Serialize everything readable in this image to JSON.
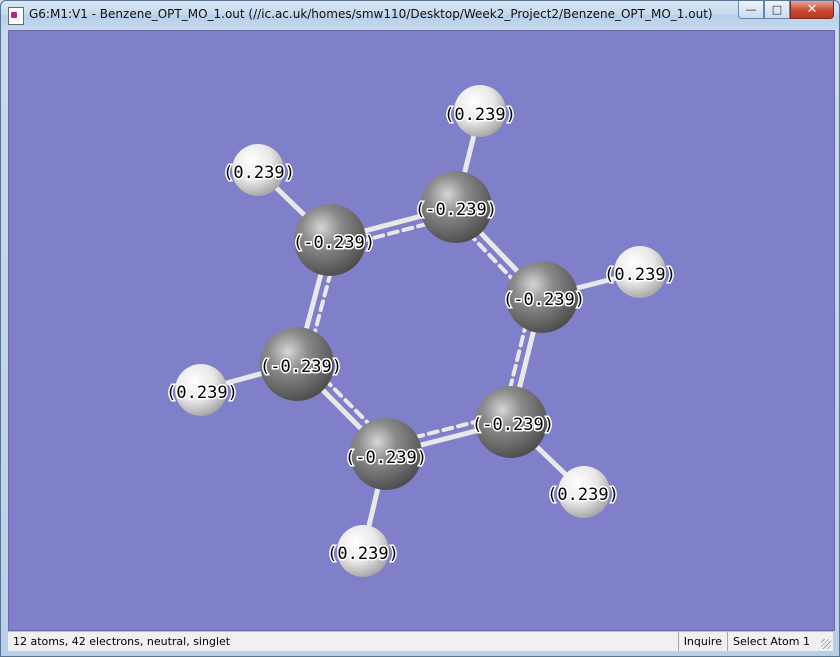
{
  "window": {
    "title": "G6:M1:V1 - Benzene_OPT_MO_1.out (//ic.ac.uk/homes/smw110/Desktop/Week2_Project2/Benzene_OPT_MO_1.out)",
    "minimize_glyph": "—",
    "maximize_glyph": "□",
    "close_glyph": "✕"
  },
  "viewer": {
    "background_color": "#807fc9",
    "carbon_color": "#7f7f7f",
    "hydrogen_color": "#f2f2f2",
    "bond_color": "#e8e8e8",
    "atoms": [
      {
        "element": "C",
        "charge": "(-0.239)"
      },
      {
        "element": "C",
        "charge": "(-0.239)"
      },
      {
        "element": "C",
        "charge": "(-0.239)"
      },
      {
        "element": "C",
        "charge": "(-0.239)"
      },
      {
        "element": "C",
        "charge": "(-0.239)"
      },
      {
        "element": "C",
        "charge": "(-0.239)"
      },
      {
        "element": "H",
        "charge": "(0.239)"
      },
      {
        "element": "H",
        "charge": "(0.239)"
      },
      {
        "element": "H",
        "charge": "(0.239)"
      },
      {
        "element": "H",
        "charge": "(0.239)"
      },
      {
        "element": "H",
        "charge": "(0.239)"
      },
      {
        "element": "H",
        "charge": "(0.239)"
      }
    ]
  },
  "status": {
    "info": "12 atoms, 42 electrons, neutral, singlet",
    "mode": "Inquire",
    "selection": "Select Atom 1"
  }
}
